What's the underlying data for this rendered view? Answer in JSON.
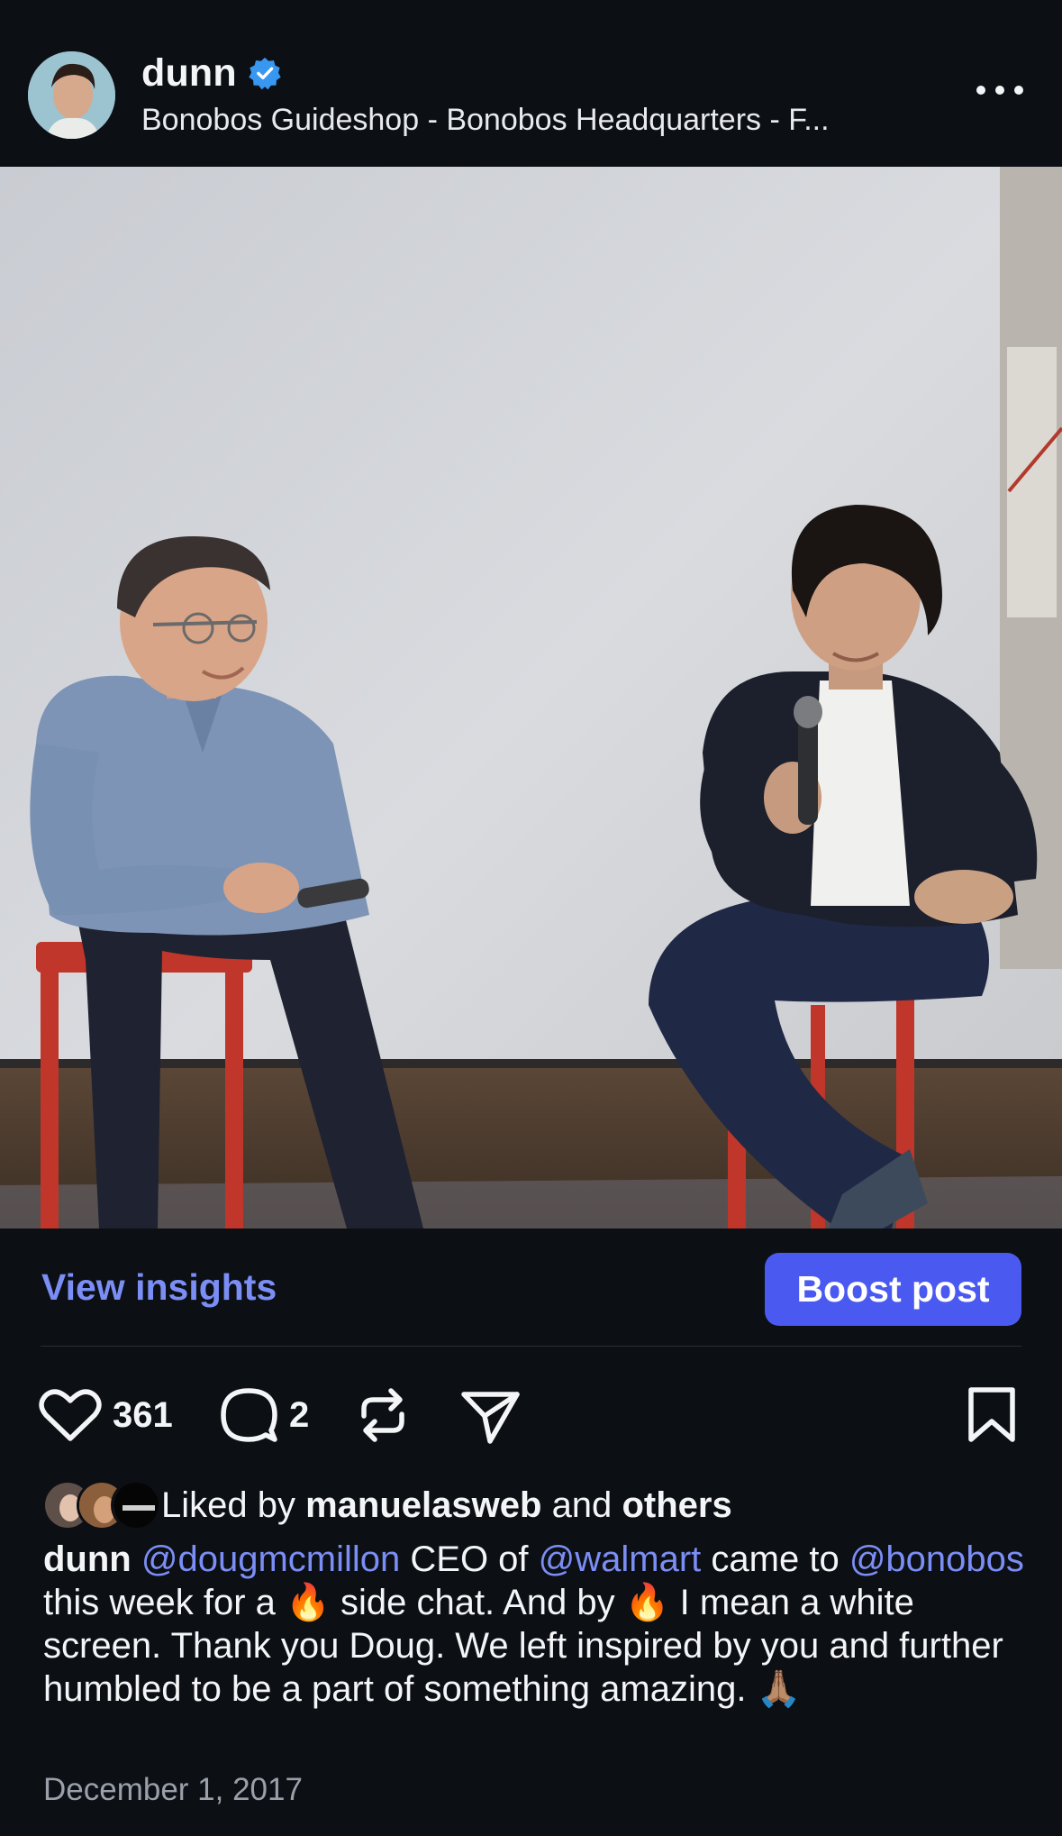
{
  "post": {
    "username": "dunn",
    "verified": true,
    "location": "Bonobos Guideshop - Bonobos Headquarters - F...",
    "more_icon": "more-horizontal-icon"
  },
  "insights": {
    "view_label": "View insights",
    "boost_label": "Boost post"
  },
  "actions": {
    "likes": "361",
    "comments": "2",
    "icons": [
      "heart-icon",
      "comment-icon",
      "repost-icon",
      "share-icon",
      "bookmark-icon"
    ]
  },
  "liked_by": {
    "prefix": "Liked by",
    "user": "manuelasweb",
    "and": "and",
    "others": "others"
  },
  "caption": {
    "username": "dunn",
    "mention1": "@dougmcmillon",
    "text1": "CEO of",
    "mention2": "@walmart",
    "text2": "came to",
    "mention3": "@bonobos",
    "text3": "this week for a",
    "emoji1": "🔥",
    "text4": "side chat. And by",
    "emoji2": "🔥",
    "text5": "I mean a white screen. Thank you Doug. We left inspired by you and further humbled to be a part of something amazing.",
    "emoji3": "🙏🏽"
  },
  "date": "December 1, 2017",
  "colors": {
    "background": "#0c0f14",
    "accent_link": "#7b8ef5",
    "boost_button": "#4a5af0",
    "verified": "#3897f0"
  }
}
